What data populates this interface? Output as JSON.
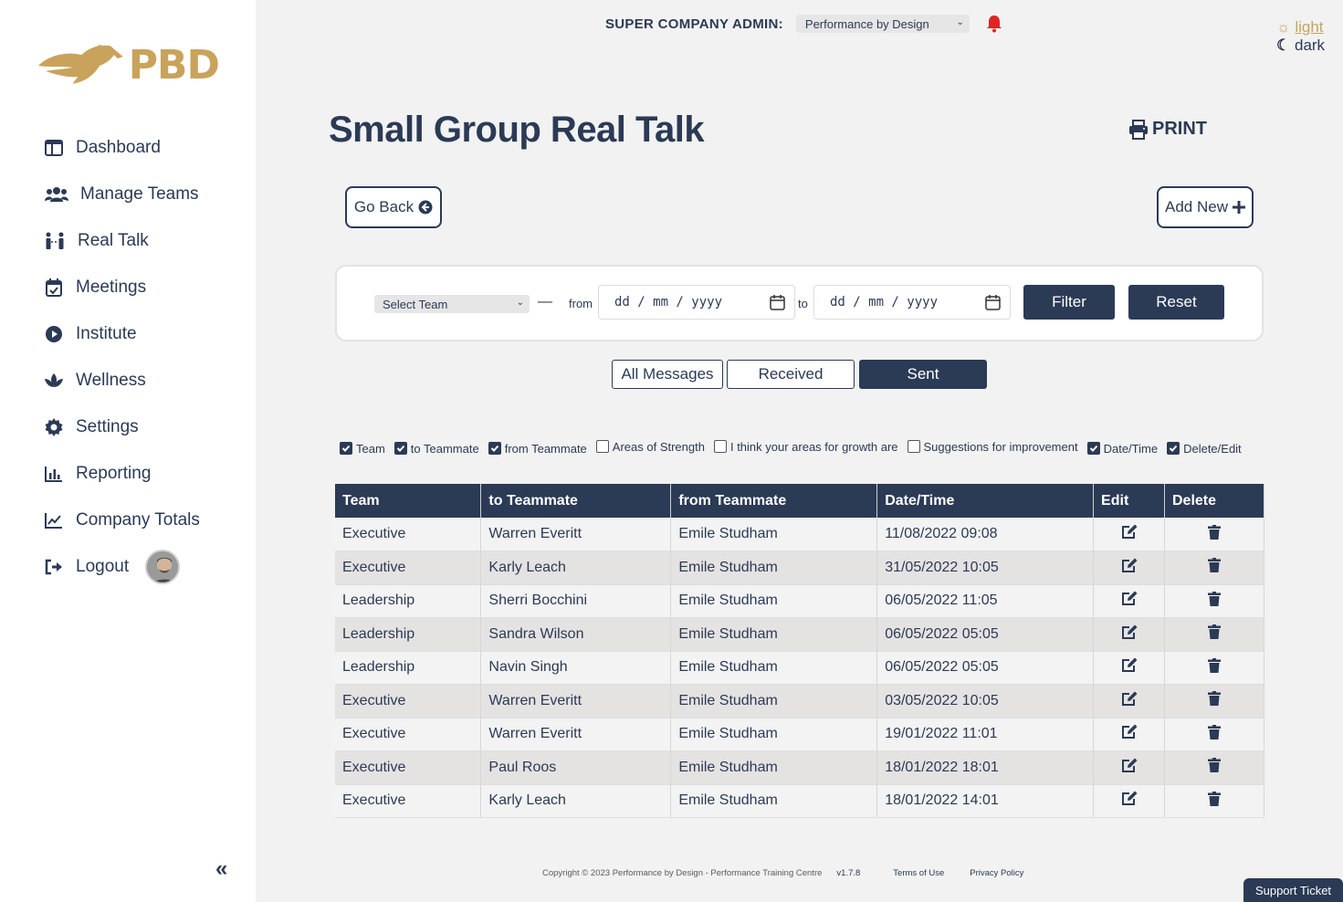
{
  "brand": {
    "logo_text": "PBD",
    "accent": "#c9a35b",
    "primary": "#2b3a55"
  },
  "sidebar": {
    "items": [
      {
        "label": "Dashboard",
        "icon": "dashboard-icon"
      },
      {
        "label": "Manage Teams",
        "icon": "users-icon"
      },
      {
        "label": "Real Talk",
        "icon": "people-talk-icon"
      },
      {
        "label": "Meetings",
        "icon": "calendar-check-icon"
      },
      {
        "label": "Institute",
        "icon": "play-circle-icon"
      },
      {
        "label": "Wellness",
        "icon": "lotus-icon"
      },
      {
        "label": "Settings",
        "icon": "gear-icon"
      },
      {
        "label": "Reporting",
        "icon": "bar-chart-icon"
      },
      {
        "label": "Company Totals",
        "icon": "line-chart-icon"
      },
      {
        "label": "Logout",
        "icon": "logout-icon"
      }
    ],
    "collapse_label": "«"
  },
  "topbar": {
    "admin_label": "SUPER COMPANY ADMIN:",
    "company_selected": "Performance by Design"
  },
  "theme": {
    "light_label": "light",
    "dark_label": "dark"
  },
  "page": {
    "title": "Small Group Real Talk",
    "print_label": "PRINT",
    "go_back_label": "Go Back",
    "add_new_label": "Add New"
  },
  "filter": {
    "team_placeholder": "Select Team",
    "dash": "—",
    "from_label": "from",
    "to_label": "to",
    "date_from_placeholder": "dd / mm / yyyy",
    "date_to_placeholder": "dd / mm / yyyy",
    "filter_label": "Filter",
    "reset_label": "Reset"
  },
  "segments": {
    "all": "All Messages",
    "received": "Received",
    "sent": "Sent",
    "active": "Sent"
  },
  "column_options": [
    {
      "label": "Team",
      "checked": true
    },
    {
      "label": "to Teammate",
      "checked": true
    },
    {
      "label": "from Teammate",
      "checked": true
    },
    {
      "label": "Areas of Strength",
      "checked": false
    },
    {
      "label": "I think your areas for growth are",
      "checked": false
    },
    {
      "label": "Suggestions for improvement",
      "checked": false
    },
    {
      "label": "Date/Time",
      "checked": true
    },
    {
      "label": "Delete/Edit",
      "checked": true
    }
  ],
  "table": {
    "headers": [
      "Team",
      "to Teammate",
      "from Teammate",
      "Date/Time",
      "Edit",
      "Delete"
    ],
    "rows": [
      [
        "Executive",
        "Warren Everitt",
        "Emile Studham",
        "11/08/2022 09:08"
      ],
      [
        "Executive",
        "Karly Leach",
        "Emile Studham",
        "31/05/2022 10:05"
      ],
      [
        "Leadership",
        "Sherri Bocchini",
        "Emile Studham",
        "06/05/2022 11:05"
      ],
      [
        "Leadership",
        "Sandra Wilson",
        "Emile Studham",
        "06/05/2022 05:05"
      ],
      [
        "Leadership",
        "Navin Singh",
        "Emile Studham",
        "06/05/2022 05:05"
      ],
      [
        "Executive",
        "Warren Everitt",
        "Emile Studham",
        "03/05/2022 10:05"
      ],
      [
        "Executive",
        "Warren Everitt",
        "Emile Studham",
        "19/01/2022 11:01"
      ],
      [
        "Executive",
        "Paul Roos",
        "Emile Studham",
        "18/01/2022 18:01"
      ],
      [
        "Executive",
        "Karly Leach",
        "Emile Studham",
        "18/01/2022 14:01"
      ]
    ]
  },
  "footer": {
    "copyright": "Copyright © 2023 Performance by Design - Performance Training Centre",
    "version": "v1.7.8",
    "terms": "Terms of Use",
    "privacy": "Privacy Policy"
  },
  "support_label": "Support Ticket"
}
